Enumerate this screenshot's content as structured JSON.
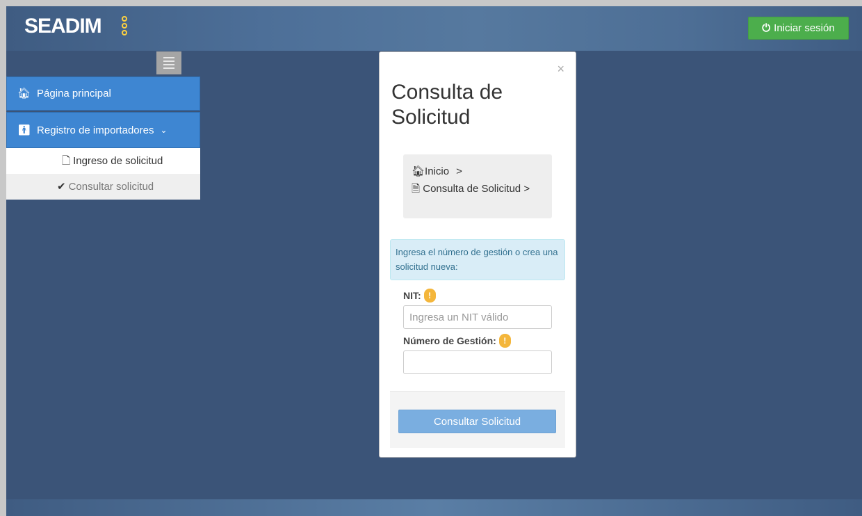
{
  "header": {
    "logo_text": "SEADIM",
    "login_button": {
      "icon": "power-icon",
      "label": "Iniciar sesión"
    }
  },
  "sidebar": {
    "menu_toggle": {
      "icon": "hamburger-icon"
    },
    "items": [
      {
        "icon": "home-icon",
        "label": "Página principal"
      },
      {
        "icon": "person-icon",
        "label": "Registro de importadores",
        "expander": "chevron-down-icon"
      }
    ],
    "subitems": [
      {
        "icon": "file-icon",
        "label": "Ingreso de solicitud"
      },
      {
        "icon": "check-icon",
        "label": "Consultar solicitud"
      }
    ]
  },
  "modal": {
    "close_label": "×",
    "title": "Consulta de Solicitud",
    "breadcrumb": {
      "home": "Inicio",
      "sep1": ">",
      "current": "Consulta de Solicitud",
      "sep2": ">"
    },
    "info_text": "Ingresa el número de gestión o crea una solicitud nueva:",
    "nit_label": "NIT:",
    "nit_placeholder": "Ingresa un NIT válido",
    "nit_value": "",
    "gestion_label": "Número de Gestión:",
    "gestion_value": "",
    "warn_glyph": "!",
    "submit_label": "Consultar Solicitud"
  },
  "colors": {
    "background": "#3b5478",
    "topbar": "#4d6f98",
    "login_button": "#4cae4c",
    "sidebar_active": "#3e86d2",
    "info_bg": "#d9edf7",
    "info_text": "#31708f",
    "warn": "#f4b63b",
    "submit": "#7aaee0"
  }
}
